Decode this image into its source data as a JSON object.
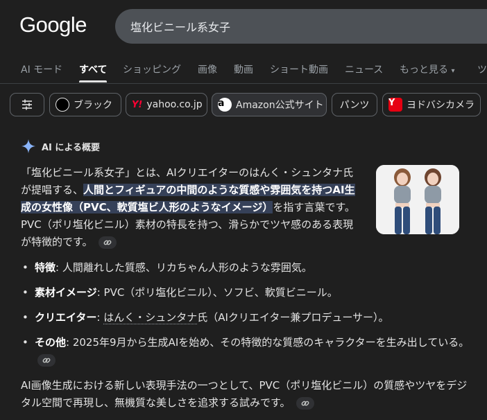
{
  "header": {
    "logo_text": "Google",
    "search_query": "塩化ビニール系女子"
  },
  "tabs": [
    {
      "label": "AI モード"
    },
    {
      "label": "すべて",
      "active": true
    },
    {
      "label": "ショッピング"
    },
    {
      "label": "画像"
    },
    {
      "label": "動画"
    },
    {
      "label": "ショート動画"
    },
    {
      "label": "ニュース"
    },
    {
      "label": "もっと見る"
    },
    {
      "label": "ツ"
    }
  ],
  "chips": [
    {
      "label": "ブラック",
      "icon": "black-circle-icon"
    },
    {
      "label": "yahoo.co.jp",
      "icon": "yahoo-logo-icon",
      "icon_text": "Y!"
    },
    {
      "label": "Amazon公式サイト",
      "icon": "amazon-logo-icon",
      "icon_text": "a"
    },
    {
      "label": "パンツ"
    },
    {
      "label": "ヨドバシカメラ",
      "icon": "yodobashi-logo-icon",
      "icon_text": "Y"
    }
  ],
  "ai_overview": {
    "header_label": "AI による概要",
    "intro": {
      "pre": "「塩化ビニール系女子」とは、AIクリエイターのはんく・シュンタナ氏が提唱する、",
      "highlight": "人間とフィギュアの中間のような質感や雰囲気を持つAI生成の女性像（PVC、軟質塩ビ人形のようなイメージ）",
      "post": "を指す言葉です。PVC（ポリ塩化ビニル）素材の特長を持つ、滑らかでツヤ感のある表現が特徴的です。"
    },
    "points": [
      {
        "term": "特徴",
        "text": ": 人間離れした質感、リカちゃん人形のような雰囲気。"
      },
      {
        "term": "素材イメージ",
        "text": ": PVC（ポリ塩化ビニル）、ソフビ、軟質ビニール。"
      },
      {
        "term": "クリエイター",
        "text_link": "はんく・シュンタナ",
        "text": "氏（AIクリエイター兼プロデューサー）。"
      },
      {
        "term": "その他",
        "text": ": 2025年9月から生成AIを始め、その特徴的な質感のキャラクターを生み出している。"
      }
    ],
    "closing": "AI画像生成における新しい表現手法の一つとして、PVC（ポリ塩化ビニル）の質感やツヤをデジタル空間で再現し、無機質な美しさを追求する試みです。"
  },
  "colors": {
    "background": "#1f1f1f",
    "highlight": "#364159",
    "ai_sparkle": "#8ab4f8"
  }
}
